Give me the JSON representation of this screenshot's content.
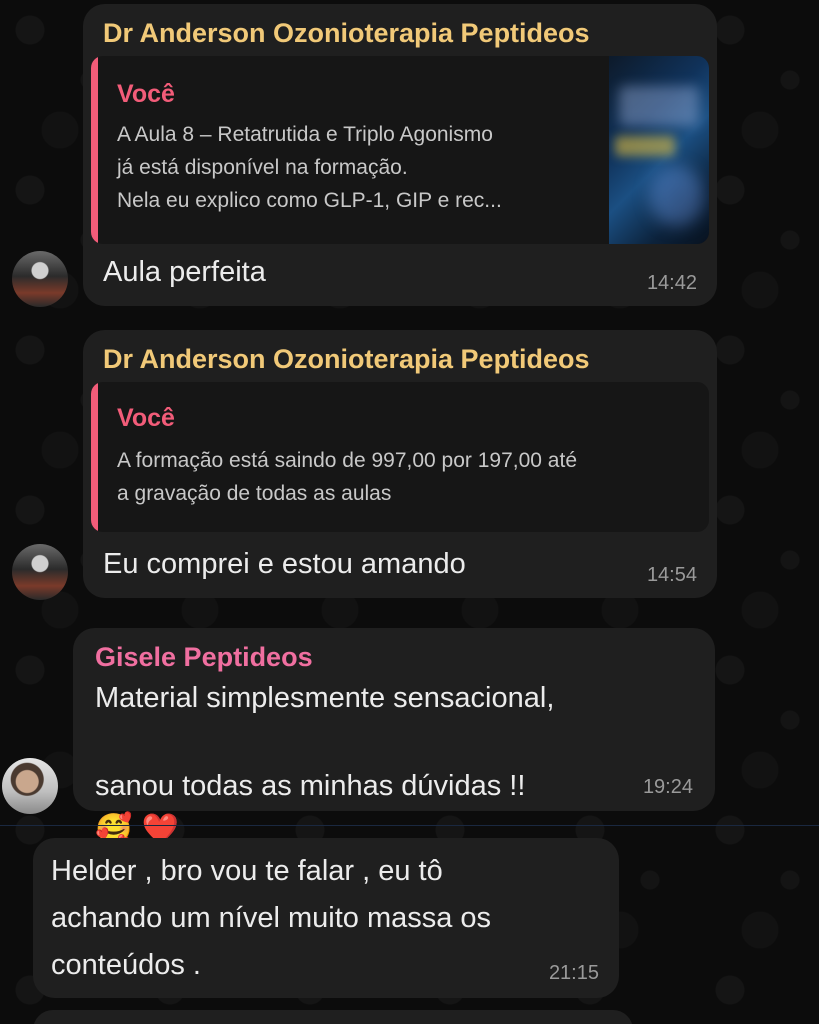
{
  "messages": [
    {
      "sender": "Dr Anderson Ozonioterapia Peptideos",
      "sender_color": "#f1c978",
      "quote_author": "Você",
      "quote_text": "A Aula 8 – Retatrutida e Triplo Agonismo\njá está disponível na formação.\nNela eu explico como GLP-1, GIP e rec...",
      "text": "Aula perfeita",
      "time": "14:42"
    },
    {
      "sender": "Dr Anderson Ozonioterapia Peptideos",
      "sender_color": "#f1c978",
      "quote_author": "Você",
      "quote_text": "A formação está saindo de 997,00 por 197,00 até\na gravação de todas as aulas",
      "text": "Eu comprei e estou amando",
      "time": "14:54"
    },
    {
      "sender": "Gisele Peptideos",
      "sender_color": "#f06fa0",
      "text_line1": "Material simplesmente sensacional,",
      "text_line2": "sanou todas as minhas dúvidas !!",
      "emoji": "🥰 ❤️",
      "time": "19:24"
    },
    {
      "text": "Helder , bro vou te falar , eu tô\nachando um nível muito massa os\nconteúdos .",
      "time": "21:15"
    }
  ]
}
